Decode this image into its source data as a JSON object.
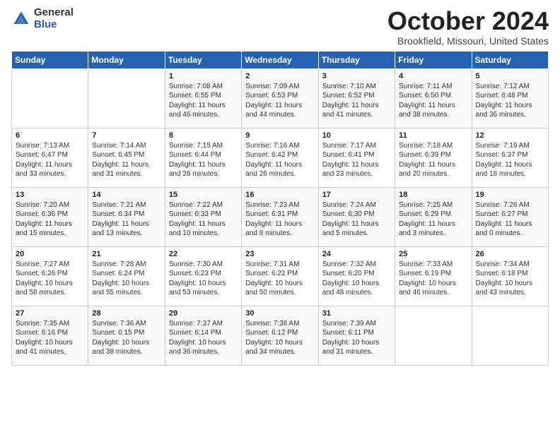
{
  "logo": {
    "general": "General",
    "blue": "Blue"
  },
  "header": {
    "title": "October 2024",
    "subtitle": "Brookfield, Missouri, United States"
  },
  "days_of_week": [
    "Sunday",
    "Monday",
    "Tuesday",
    "Wednesday",
    "Thursday",
    "Friday",
    "Saturday"
  ],
  "weeks": [
    [
      {
        "day": "",
        "info": ""
      },
      {
        "day": "",
        "info": ""
      },
      {
        "day": "1",
        "info": "Sunrise: 7:08 AM\nSunset: 6:55 PM\nDaylight: 11 hours and 46 minutes."
      },
      {
        "day": "2",
        "info": "Sunrise: 7:09 AM\nSunset: 6:53 PM\nDaylight: 11 hours and 44 minutes."
      },
      {
        "day": "3",
        "info": "Sunrise: 7:10 AM\nSunset: 6:52 PM\nDaylight: 11 hours and 41 minutes."
      },
      {
        "day": "4",
        "info": "Sunrise: 7:11 AM\nSunset: 6:50 PM\nDaylight: 11 hours and 38 minutes."
      },
      {
        "day": "5",
        "info": "Sunrise: 7:12 AM\nSunset: 6:48 PM\nDaylight: 11 hours and 36 minutes."
      }
    ],
    [
      {
        "day": "6",
        "info": "Sunrise: 7:13 AM\nSunset: 6:47 PM\nDaylight: 11 hours and 33 minutes."
      },
      {
        "day": "7",
        "info": "Sunrise: 7:14 AM\nSunset: 6:45 PM\nDaylight: 11 hours and 31 minutes."
      },
      {
        "day": "8",
        "info": "Sunrise: 7:15 AM\nSunset: 6:44 PM\nDaylight: 11 hours and 28 minutes."
      },
      {
        "day": "9",
        "info": "Sunrise: 7:16 AM\nSunset: 6:42 PM\nDaylight: 11 hours and 26 minutes."
      },
      {
        "day": "10",
        "info": "Sunrise: 7:17 AM\nSunset: 6:41 PM\nDaylight: 11 hours and 23 minutes."
      },
      {
        "day": "11",
        "info": "Sunrise: 7:18 AM\nSunset: 6:39 PM\nDaylight: 11 hours and 20 minutes."
      },
      {
        "day": "12",
        "info": "Sunrise: 7:19 AM\nSunset: 6:37 PM\nDaylight: 11 hours and 18 minutes."
      }
    ],
    [
      {
        "day": "13",
        "info": "Sunrise: 7:20 AM\nSunset: 6:36 PM\nDaylight: 11 hours and 15 minutes."
      },
      {
        "day": "14",
        "info": "Sunrise: 7:21 AM\nSunset: 6:34 PM\nDaylight: 11 hours and 13 minutes."
      },
      {
        "day": "15",
        "info": "Sunrise: 7:22 AM\nSunset: 6:33 PM\nDaylight: 11 hours and 10 minutes."
      },
      {
        "day": "16",
        "info": "Sunrise: 7:23 AM\nSunset: 6:31 PM\nDaylight: 11 hours and 8 minutes."
      },
      {
        "day": "17",
        "info": "Sunrise: 7:24 AM\nSunset: 6:30 PM\nDaylight: 11 hours and 5 minutes."
      },
      {
        "day": "18",
        "info": "Sunrise: 7:25 AM\nSunset: 6:29 PM\nDaylight: 11 hours and 3 minutes."
      },
      {
        "day": "19",
        "info": "Sunrise: 7:26 AM\nSunset: 6:27 PM\nDaylight: 11 hours and 0 minutes."
      }
    ],
    [
      {
        "day": "20",
        "info": "Sunrise: 7:27 AM\nSunset: 6:26 PM\nDaylight: 10 hours and 58 minutes."
      },
      {
        "day": "21",
        "info": "Sunrise: 7:28 AM\nSunset: 6:24 PM\nDaylight: 10 hours and 55 minutes."
      },
      {
        "day": "22",
        "info": "Sunrise: 7:30 AM\nSunset: 6:23 PM\nDaylight: 10 hours and 53 minutes."
      },
      {
        "day": "23",
        "info": "Sunrise: 7:31 AM\nSunset: 6:22 PM\nDaylight: 10 hours and 50 minutes."
      },
      {
        "day": "24",
        "info": "Sunrise: 7:32 AM\nSunset: 6:20 PM\nDaylight: 10 hours and 48 minutes."
      },
      {
        "day": "25",
        "info": "Sunrise: 7:33 AM\nSunset: 6:19 PM\nDaylight: 10 hours and 46 minutes."
      },
      {
        "day": "26",
        "info": "Sunrise: 7:34 AM\nSunset: 6:18 PM\nDaylight: 10 hours and 43 minutes."
      }
    ],
    [
      {
        "day": "27",
        "info": "Sunrise: 7:35 AM\nSunset: 6:16 PM\nDaylight: 10 hours and 41 minutes."
      },
      {
        "day": "28",
        "info": "Sunrise: 7:36 AM\nSunset: 6:15 PM\nDaylight: 10 hours and 38 minutes."
      },
      {
        "day": "29",
        "info": "Sunrise: 7:37 AM\nSunset: 6:14 PM\nDaylight: 10 hours and 36 minutes."
      },
      {
        "day": "30",
        "info": "Sunrise: 7:38 AM\nSunset: 6:12 PM\nDaylight: 10 hours and 34 minutes."
      },
      {
        "day": "31",
        "info": "Sunrise: 7:39 AM\nSunset: 6:11 PM\nDaylight: 10 hours and 31 minutes."
      },
      {
        "day": "",
        "info": ""
      },
      {
        "day": "",
        "info": ""
      }
    ]
  ]
}
